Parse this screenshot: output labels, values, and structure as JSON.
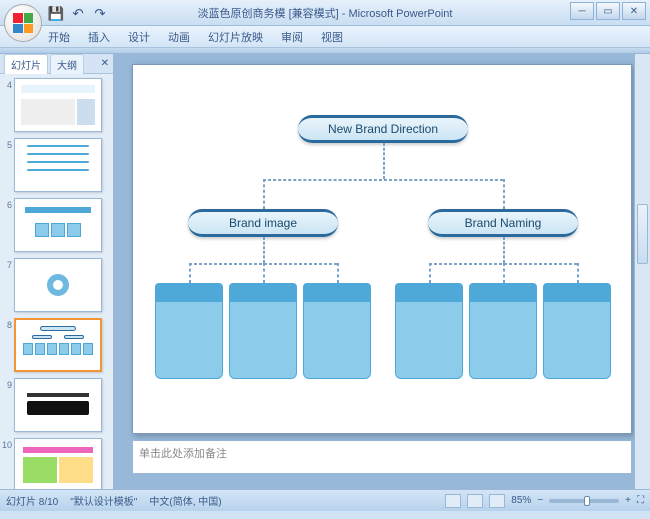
{
  "title": "淡蓝色原创商务模 [兼容模式] - Microsoft PowerPoint",
  "menu": {
    "items": [
      "开始",
      "插入",
      "设计",
      "动画",
      "幻灯片放映",
      "审阅",
      "视图"
    ]
  },
  "side_tabs": {
    "slides": "幻灯片",
    "outline": "大纲"
  },
  "thumbs": [
    {
      "n": "4"
    },
    {
      "n": "5"
    },
    {
      "n": "6"
    },
    {
      "n": "7"
    },
    {
      "n": "8"
    },
    {
      "n": "9"
    },
    {
      "n": "10"
    }
  ],
  "selected_thumb": 4,
  "slide": {
    "top": "New Brand Direction",
    "left": "Brand image",
    "right": "Brand Naming"
  },
  "notes_placeholder": "单击此处添加备注",
  "status": {
    "slide": "幻灯片 8/10",
    "template": "\"默认设计模板\"",
    "lang": "中文(简体, 中国)",
    "zoom": "85%"
  }
}
